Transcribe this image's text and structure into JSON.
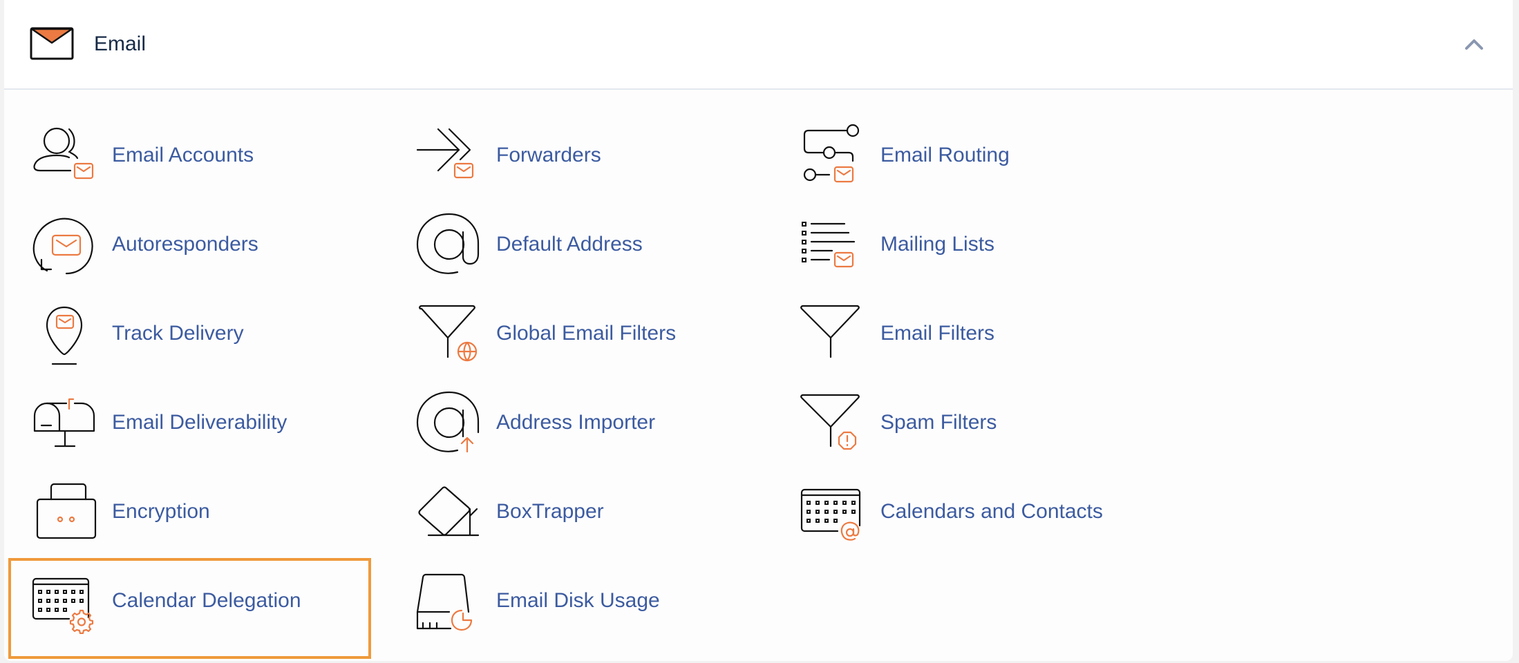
{
  "section": {
    "title": "Email",
    "icon": "envelope-icon",
    "collapse_icon": "chevron-up-icon",
    "expanded": true
  },
  "colors": {
    "accent_orange": "#ec7a42",
    "link_blue": "#3c5ba0",
    "title_navy": "#172a46",
    "highlight_border": "#ef9a3b"
  },
  "items": [
    {
      "label": "Email Accounts",
      "icon": "user-mail-icon"
    },
    {
      "label": "Forwarders",
      "icon": "forward-mail-icon"
    },
    {
      "label": "Email Routing",
      "icon": "routing-mail-icon"
    },
    {
      "label": "Autoresponders",
      "icon": "auto-reply-mail-icon"
    },
    {
      "label": "Default Address",
      "icon": "at-sign-icon"
    },
    {
      "label": "Mailing Lists",
      "icon": "list-mail-icon"
    },
    {
      "label": "Track Delivery",
      "icon": "location-pin-mail-icon"
    },
    {
      "label": "Global Email Filters",
      "icon": "filter-globe-icon"
    },
    {
      "label": "Email Filters",
      "icon": "filter-icon"
    },
    {
      "label": "Email Deliverability",
      "icon": "mailbox-icon"
    },
    {
      "label": "Address Importer",
      "icon": "at-sign-upload-icon"
    },
    {
      "label": "Spam Filters",
      "icon": "filter-warning-icon"
    },
    {
      "label": "Encryption",
      "icon": "lock-icon"
    },
    {
      "label": "BoxTrapper",
      "icon": "box-trap-icon"
    },
    {
      "label": "Calendars and Contacts",
      "icon": "calendar-at-icon"
    },
    {
      "label": "Calendar Delegation",
      "icon": "calendar-gear-icon",
      "highlighted": true
    },
    {
      "label": "Email Disk Usage",
      "icon": "disk-usage-icon"
    }
  ]
}
